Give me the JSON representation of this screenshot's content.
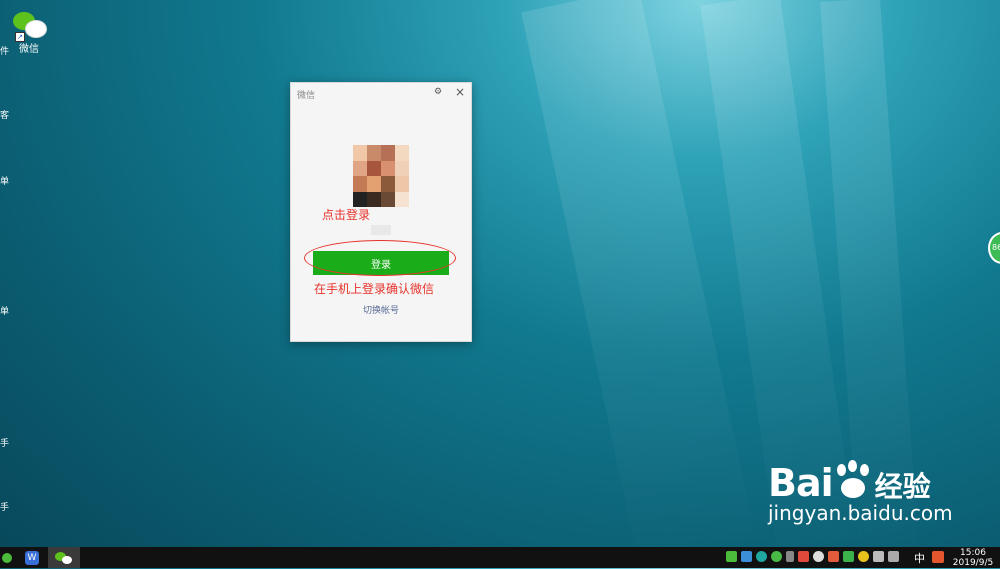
{
  "desktop": {
    "icons": [
      {
        "label": "微信",
        "icon": "wechat-icon"
      }
    ],
    "edge_labels": [
      "件",
      "客",
      "单",
      "单",
      "手",
      "手"
    ]
  },
  "window": {
    "title": "微信",
    "settings_icon": "gear-icon",
    "close_icon": "close-icon",
    "login_button": "登录",
    "switch_account": "切换帐号"
  },
  "annotations": {
    "click_login": "点击登录",
    "confirm_on_phone": "在手机上登录确认微信"
  },
  "floating_widget": {
    "text": "86"
  },
  "watermark": {
    "brand": "Bai",
    "brand_tail": "经验",
    "url": "jingyan.baidu.com"
  },
  "taskbar": {
    "ime": "中",
    "time": "15:06",
    "date": "2019/9/5"
  },
  "colors": {
    "login_green": "#1aad19",
    "annotation_red": "#e8322b",
    "link_blue": "#576b95"
  }
}
